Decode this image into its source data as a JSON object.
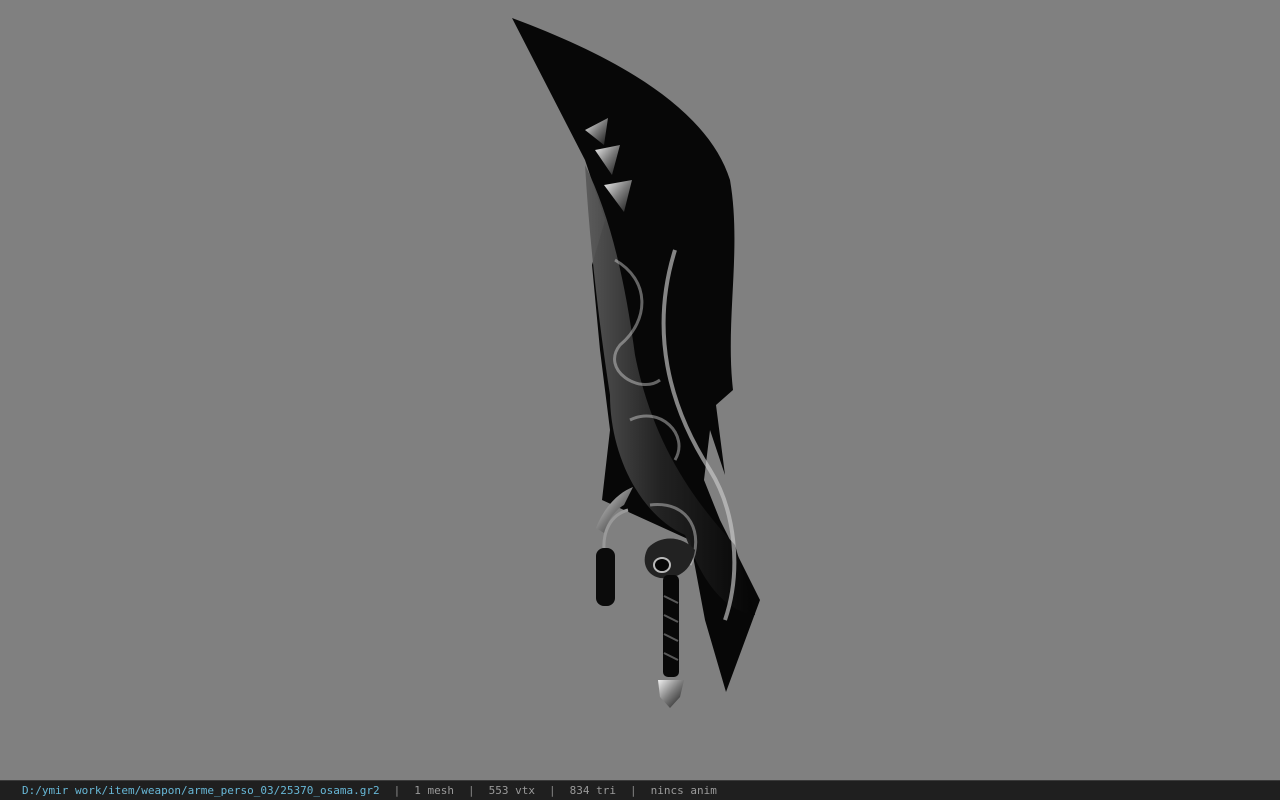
{
  "viewport": {
    "background_color": "#808080",
    "model": {
      "icon": "curved-sword-model"
    }
  },
  "status_bar": {
    "file_path": "D:/ymir work/item/weapon/arme_perso_03/25370_osama.gr2",
    "separator": "|",
    "mesh_count": "1 mesh",
    "vertex_count": "553 vtx",
    "triangle_count": "834 tri",
    "animation_status": "nincs anim",
    "path_color": "#67b7d6",
    "text_color": "#9a9a9a"
  }
}
